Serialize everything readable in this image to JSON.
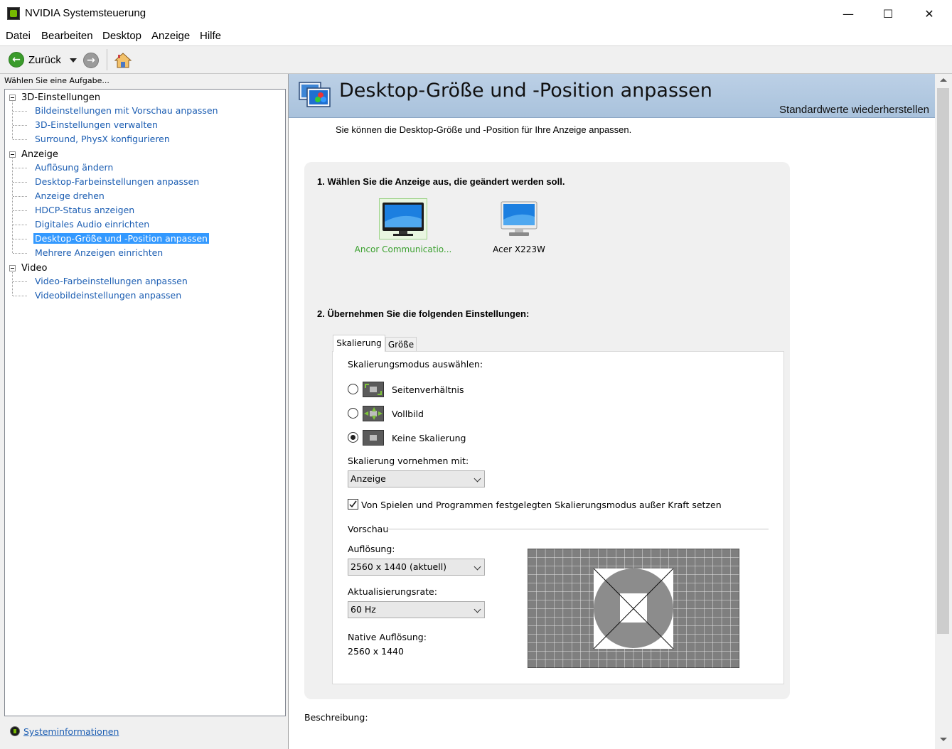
{
  "window": {
    "title": "NVIDIA Systemsteuerung",
    "minimize": "—",
    "maximize": "☐",
    "close": "✕"
  },
  "menu": [
    "Datei",
    "Bearbeiten",
    "Desktop",
    "Anzeige",
    "Hilfe"
  ],
  "toolbar": {
    "back_label": "Zurück"
  },
  "left_panel": {
    "header": "Wählen Sie eine Aufgabe...",
    "categories": [
      {
        "label": "3D-Einstellungen",
        "items": [
          "Bildeinstellungen mit Vorschau anpassen",
          "3D-Einstellungen verwalten",
          "Surround, PhysX konfigurieren"
        ]
      },
      {
        "label": "Anzeige",
        "items": [
          "Auflösung ändern",
          "Desktop-Farbeinstellungen anpassen",
          "Anzeige drehen",
          "HDCP-Status anzeigen",
          "Digitales Audio einrichten",
          "Desktop-Größe und -Position anpassen",
          "Mehrere Anzeigen einrichten"
        ]
      },
      {
        "label": "Video",
        "items": [
          "Video-Farbeinstellungen anpassen",
          "Videobildeinstellungen anpassen"
        ]
      }
    ],
    "selected_item": "Desktop-Größe und -Position anpassen",
    "system_info": "Systeminformationen"
  },
  "main": {
    "title": "Desktop-Größe und -Position anpassen",
    "restore_defaults": "Standardwerte wiederherstellen",
    "intro": "Sie können die Desktop-Größe und -Position für Ihre Anzeige anpassen.",
    "step1": "1. Wählen Sie die Anzeige aus, die geändert werden soll.",
    "displays": [
      "Ancor Communicatio...",
      "Acer X223W"
    ],
    "step2": "2. Übernehmen Sie die folgenden Einstellungen:",
    "tabs": [
      "Skalierung",
      "Größe"
    ],
    "scaling_mode_label": "Skalierungsmodus auswählen:",
    "scaling_options": [
      "Seitenverhältnis",
      "Vollbild",
      "Keine Skalierung"
    ],
    "selected_scaling": "Keine Skalierung",
    "perform_scaling_label": "Skalierung vornehmen mit:",
    "perform_scaling_value": "Anzeige",
    "override_checkbox": "Von Spielen und Programmen festgelegten Skalierungsmodus außer Kraft setzen",
    "override_checked": true,
    "preview_label": "Vorschau",
    "resolution_label": "Auflösung:",
    "resolution_value": "2560 x 1440 (aktuell)",
    "refresh_label": "Aktualisierungsrate:",
    "refresh_value": "60 Hz",
    "native_label": "Native Auflösung:",
    "native_value": "2560 x 1440",
    "description_label": "Beschreibung:"
  },
  "colors": {
    "accent_green": "#76b900",
    "link_blue": "#1b5db2",
    "selection": "#3399ff"
  }
}
